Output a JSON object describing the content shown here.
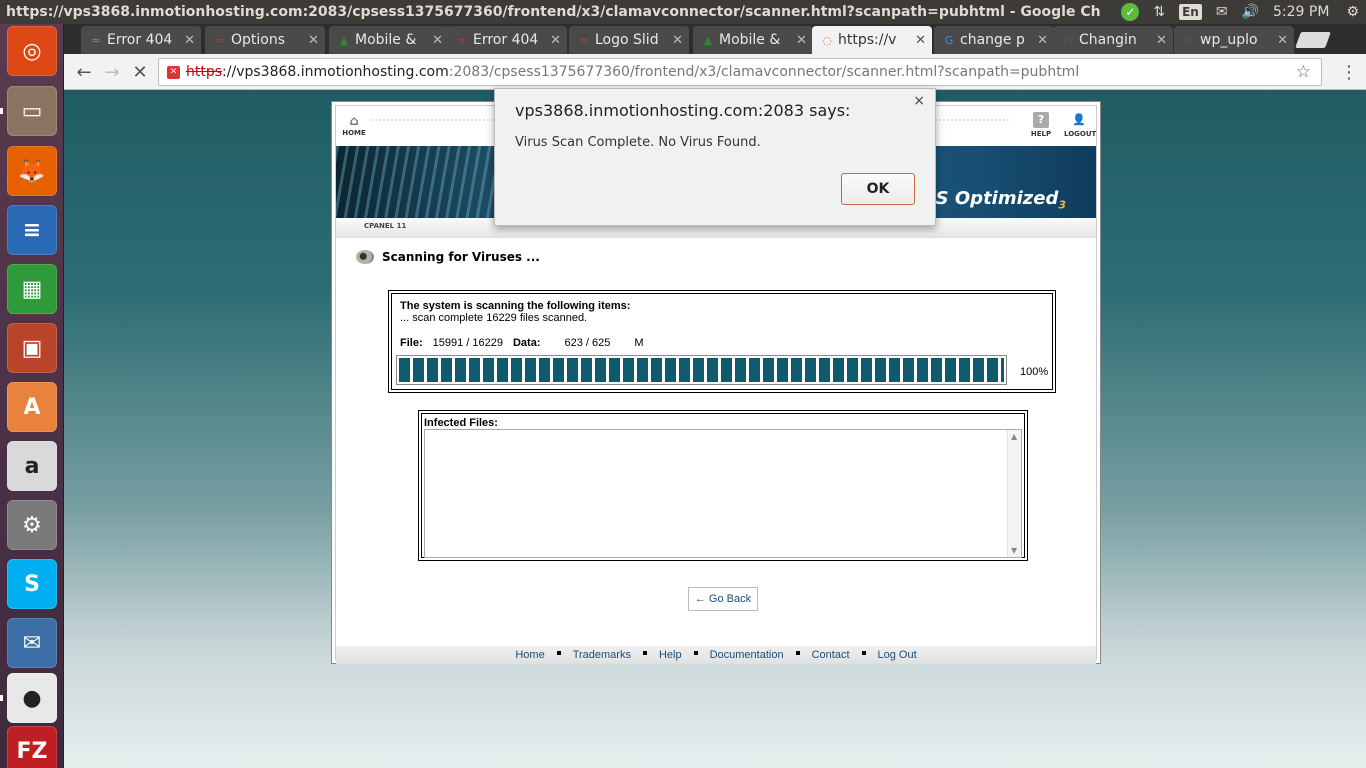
{
  "panel": {
    "window_title": "https://vps3868.inmotionhosting.com:2083/cpsess1375677360/frontend/x3/clamavconnector/scanner.html?scanpath=pubhtml - Google Chrome",
    "lang": "En",
    "clock": "5:29 PM"
  },
  "tabs": [
    {
      "label": "Error 404",
      "icon": "error-icon",
      "color": "#888"
    },
    {
      "label": "Options",
      "icon": "brand-wave-icon",
      "color": "#c33"
    },
    {
      "label": "Mobile &",
      "icon": "green-arrow-icon",
      "color": "#2c8a2c"
    },
    {
      "label": "Error 404",
      "icon": "brand-wave-icon",
      "color": "#c33"
    },
    {
      "label": "Logo Slid",
      "icon": "brand-wave-icon",
      "color": "#c33"
    },
    {
      "label": "Mobile &",
      "icon": "green-arrow-icon",
      "color": "#2c8a2c"
    },
    {
      "label": "https://v",
      "icon": "loading-spinner-icon",
      "color": "#e0622b"
    },
    {
      "label": "change p",
      "icon": "google-icon",
      "color": "#4285f4"
    },
    {
      "label": "Changin",
      "icon": "wordpress-icon",
      "color": "#555"
    },
    {
      "label": "wp_uplo",
      "icon": "wordpress-icon",
      "color": "#555"
    }
  ],
  "omnibox": {
    "scheme": "https",
    "host": "://vps3868.inmotionhosting.com",
    "rest": ":2083/cpsess1375677360/frontend/x3/clamavconnector/scanner.html?scanpath=pubhtml"
  },
  "cpanel": {
    "home_label": "HOME",
    "help_label": "HELP",
    "logout_label": "LOGOUT",
    "banner_text": "VPS Optimized",
    "banner_sub": "3",
    "version_label": "CPANEL 11",
    "scan_title": "Scanning for Viruses ...",
    "status_heading": "The system is scanning the following items:",
    "status_sub": "... scan complete 16229 files scanned.",
    "file_label": "File:",
    "file_value": "15991 / 16229",
    "data_label": "Data:",
    "data_value": "623 / 625",
    "data_unit": "M",
    "progress_percent": "100%",
    "progress_fraction": 1.0,
    "infected_label": "Infected Files:",
    "go_back": "← Go Back",
    "footer": [
      "Home",
      "Trademarks",
      "Help",
      "Documentation",
      "Contact",
      "Log Out"
    ]
  },
  "dialog": {
    "title": "vps3868.inmotionhosting.com:2083 says:",
    "message": "Virus Scan Complete.  No Virus Found.",
    "ok": "OK"
  },
  "launcher": [
    {
      "name": "ubuntu-dash-icon",
      "color": "#dd4814",
      "glyph": "◎"
    },
    {
      "name": "files-icon",
      "color": "#8a7460",
      "glyph": "▭"
    },
    {
      "name": "firefox-icon",
      "color": "#e66000",
      "glyph": "🦊"
    },
    {
      "name": "writer-icon",
      "color": "#2a69b3",
      "glyph": "≡"
    },
    {
      "name": "calc-icon",
      "color": "#2e9a3a",
      "glyph": "▦"
    },
    {
      "name": "impress-icon",
      "color": "#b8452a",
      "glyph": "▣"
    },
    {
      "name": "software-center-icon",
      "color": "#e8823c",
      "glyph": "A"
    },
    {
      "name": "amazon-icon",
      "color": "#d9d9d9",
      "glyph": "a"
    },
    {
      "name": "system-settings-icon",
      "color": "#7a7a7a",
      "glyph": "⚙"
    },
    {
      "name": "skype-icon",
      "color": "#00aff0",
      "glyph": "S"
    },
    {
      "name": "thunderbird-icon",
      "color": "#3a6ea5",
      "glyph": "✉"
    },
    {
      "name": "chrome-icon",
      "color": "#e8e8e8",
      "glyph": "●"
    },
    {
      "name": "filezilla-icon",
      "color": "#bf1e22",
      "glyph": "FZ"
    }
  ]
}
